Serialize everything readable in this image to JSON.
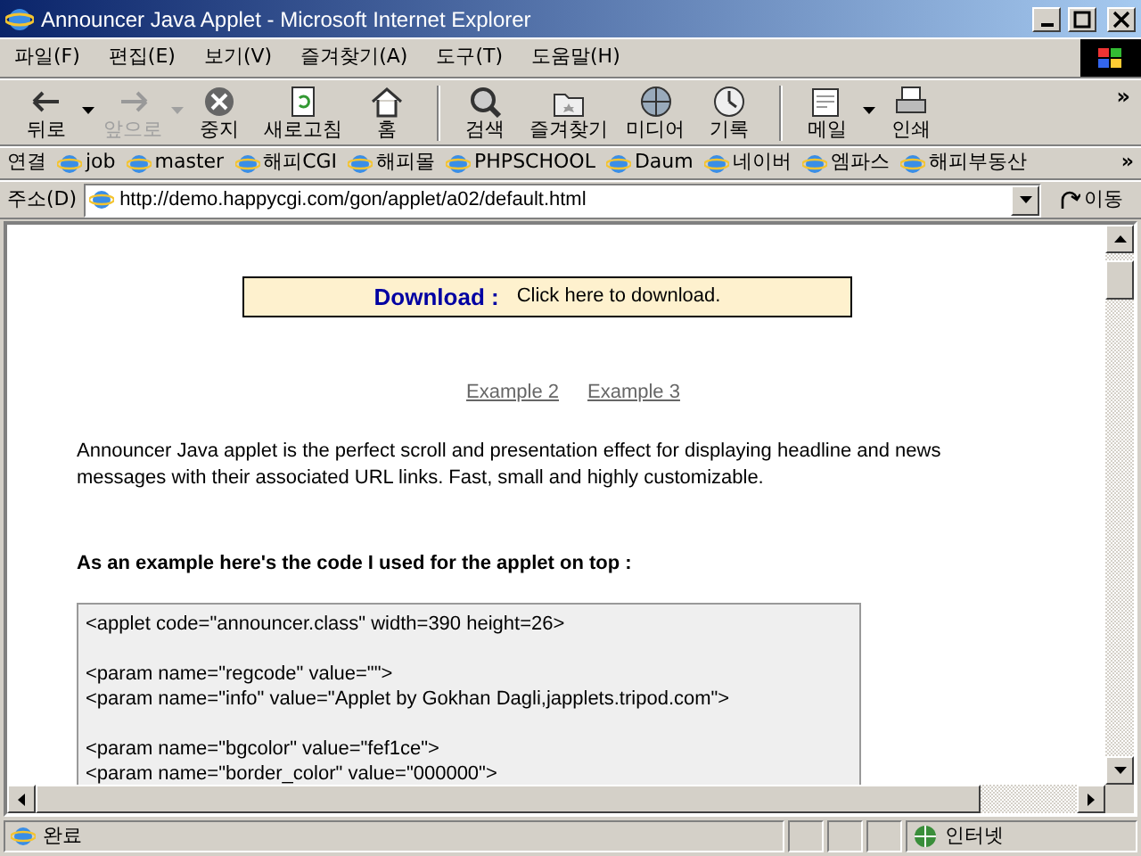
{
  "window": {
    "title": "Announcer Java Applet - Microsoft Internet Explorer"
  },
  "menu": [
    "파일(F)",
    "편집(E)",
    "보기(V)",
    "즐겨찾기(A)",
    "도구(T)",
    "도움말(H)"
  ],
  "toolbar": [
    {
      "label": "뒤로",
      "disabled": false,
      "dropdown": true,
      "separator_before": false
    },
    {
      "label": "앞으로",
      "disabled": true,
      "dropdown": true,
      "separator_before": false
    },
    {
      "label": "중지",
      "disabled": false,
      "dropdown": false,
      "separator_before": false
    },
    {
      "label": "새로고침",
      "disabled": false,
      "dropdown": false,
      "separator_before": false
    },
    {
      "label": "홈",
      "disabled": false,
      "dropdown": false,
      "separator_before": false
    },
    {
      "label": "검색",
      "disabled": false,
      "dropdown": false,
      "separator_before": true
    },
    {
      "label": "즐겨찾기",
      "disabled": false,
      "dropdown": false,
      "separator_before": false
    },
    {
      "label": "미디어",
      "disabled": false,
      "dropdown": false,
      "separator_before": false
    },
    {
      "label": "기록",
      "disabled": false,
      "dropdown": false,
      "separator_before": false
    },
    {
      "label": "메일",
      "disabled": false,
      "dropdown": true,
      "separator_before": true
    },
    {
      "label": "인쇄",
      "disabled": false,
      "dropdown": false,
      "separator_before": false
    }
  ],
  "toolbar_more": "»",
  "links_bar": {
    "label": "연결",
    "items": [
      "job",
      "master",
      "해피CGI",
      "해피몰",
      "PHPSCHOOL",
      "Daum",
      "네이버",
      "엠파스",
      "해피부동산"
    ],
    "more": "»"
  },
  "address_bar": {
    "label": "주소(D)",
    "url": "http://demo.happycgi.com/gon/applet/a02/default.html",
    "go": "이동"
  },
  "page": {
    "download_label": "Download :",
    "download_text": "Click here to download.",
    "example_links": [
      "Example 2",
      "Example 3"
    ],
    "intro": "Announcer Java applet is the perfect scroll and presentation effect for displaying headline and news messages with their associated URL links. Fast, small and highly customizable.",
    "code_heading": "As an example here's the code I used for the applet on top :",
    "code_blocks": [
      [
        "<applet code=\"announcer.class\" width=390 height=26>"
      ],
      [
        "<param name=\"regcode\" value=\"\">",
        "<param name=\"info\" value=\"Applet by Gokhan Dagli,japplets.tripod.com\">"
      ],
      [
        "<param name=\"bgcolor\" value=\"fef1ce\">",
        "<param name=\"border_color\" value=\"000000\">"
      ]
    ]
  },
  "status_bar": {
    "text": "완료",
    "zone": "인터넷"
  }
}
